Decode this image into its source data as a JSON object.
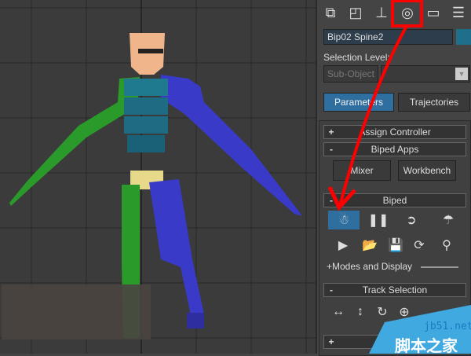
{
  "panel": {
    "tabs": [
      {
        "name": "create"
      },
      {
        "name": "modify"
      },
      {
        "name": "hierarchy"
      },
      {
        "name": "motion"
      },
      {
        "name": "display"
      },
      {
        "name": "utilities"
      }
    ],
    "object_name": "Bip02 Spine2",
    "color_swatch": "#1f6e8c",
    "selection_level_label": "Selection Level:",
    "sub_object_label": "Sub-Object",
    "parameters_label": "Parameters",
    "trajectories_label": "Trajectories",
    "rollouts": {
      "assign_controller": {
        "sign": "+",
        "title": "Assign Controller"
      },
      "biped_apps": {
        "sign": "-",
        "title": "Biped Apps",
        "mixer": "Mixer",
        "workbench": "Workbench"
      },
      "biped": {
        "sign": "-",
        "title": "Biped",
        "modes_and_display": "+Modes and Display"
      },
      "track_selection": {
        "sign": "-",
        "title": "Track Selection"
      },
      "collapsed": {
        "sign": "+"
      }
    }
  },
  "watermark": {
    "site": "jb51.net",
    "name": "脚本之家"
  },
  "colors": {
    "accent": "#2f6fa0",
    "annotation": "#ff0000"
  }
}
